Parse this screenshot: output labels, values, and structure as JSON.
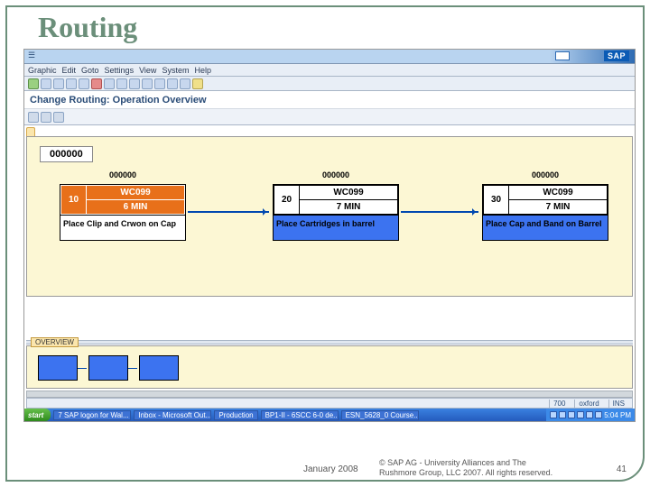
{
  "slide": {
    "title": "Routing"
  },
  "app": {
    "window_title": "☰",
    "logo": "SAP",
    "menu": [
      "Graphic",
      "Edit",
      "Goto",
      "Settings",
      "View",
      "System",
      "Help"
    ],
    "subtitle": "Change Routing: Operation Overview",
    "header_id": "000000",
    "operations": [
      {
        "top_id": "000000",
        "num": "10",
        "wc": "WC099",
        "time": "6 MIN",
        "desc": "Place Clip and Crwon on Cap",
        "style": "orange"
      },
      {
        "top_id": "000000",
        "num": "20",
        "wc": "WC099",
        "time": "7 MIN",
        "desc": "Place Cartridges in barrel",
        "style": "blue"
      },
      {
        "top_id": "000000",
        "num": "30",
        "wc": "WC099",
        "time": "7 MIN",
        "desc": "Place Cap and Band on Barrel",
        "style": "blue"
      }
    ],
    "overview_label": "OVERVIEW",
    "status": {
      "server": "700",
      "client": "oxford",
      "ins": "INS"
    }
  },
  "taskbar": {
    "start": "start",
    "tasks": [
      "7 SAP logon for Wal...",
      "Inbox - Microsoft Out...",
      "Production",
      "BP1-II - 6SCC 6-0 de...",
      "ESN_5628_0 Course..."
    ],
    "clock": "5:04 PM"
  },
  "footer": {
    "date": "January 2008",
    "copyright": "© SAP AG - University Alliances and The Rushmore Group, LLC 2007. All rights reserved.",
    "page": "41"
  }
}
